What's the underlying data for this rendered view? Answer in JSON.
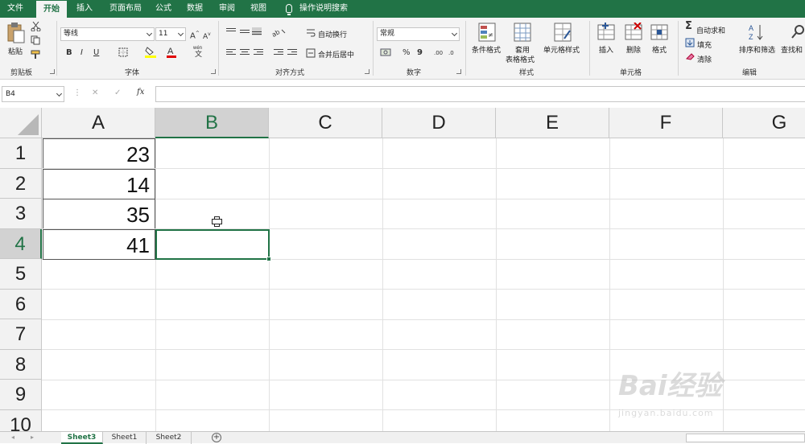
{
  "menu_tabs": [
    "文件",
    "开始",
    "插入",
    "页面布局",
    "公式",
    "数据",
    "审阅",
    "视图",
    "操作说明搜索"
  ],
  "active_tab": "开始",
  "ribbon": {
    "clipboard": {
      "paste": "粘贴",
      "label": "剪贴板"
    },
    "font": {
      "name": "等线",
      "size": "11",
      "label": "字体",
      "bold": "B",
      "italic": "I",
      "underline": "U",
      "grow": "A",
      "shrink": "A"
    },
    "alignment": {
      "wrap": "自动换行",
      "merge": "合并后居中",
      "label": "对齐方式"
    },
    "number": {
      "format": "常规",
      "percent": "%",
      "comma": "9",
      "label": "数字"
    },
    "styles": {
      "conditional": "条件格式",
      "table_line1": "套用",
      "table_line2": "表格格式",
      "cell_styles": "单元格样式",
      "label": "样式"
    },
    "cells": {
      "insert": "插入",
      "delete": "删除",
      "format": "格式",
      "label": "单元格"
    },
    "editing": {
      "autosum": "自动求和",
      "fill": "填充",
      "clear": "清除",
      "sort": "排序和筛选",
      "find": "查找和",
      "label": "编辑"
    }
  },
  "formula_bar": {
    "name_box": "B4",
    "fx": "fx",
    "formula": ""
  },
  "columns": [
    "A",
    "B",
    "C",
    "D",
    "E",
    "F",
    "G"
  ],
  "rows": [
    "1",
    "2",
    "3",
    "4",
    "5",
    "6",
    "7",
    "8",
    "9",
    "10"
  ],
  "selected_cell": "B4",
  "cells": {
    "A1": "23",
    "A2": "14",
    "A3": "35",
    "A4": "41"
  },
  "sheets": [
    "Sheet3",
    "Sheet1",
    "Sheet2"
  ],
  "active_sheet": "Sheet3",
  "watermark": {
    "brand": "Bai经验",
    "url": "jingyan.baidu.com"
  },
  "colors": {
    "accent": "#217346",
    "ribbon_bg": "#f3f3f3"
  }
}
